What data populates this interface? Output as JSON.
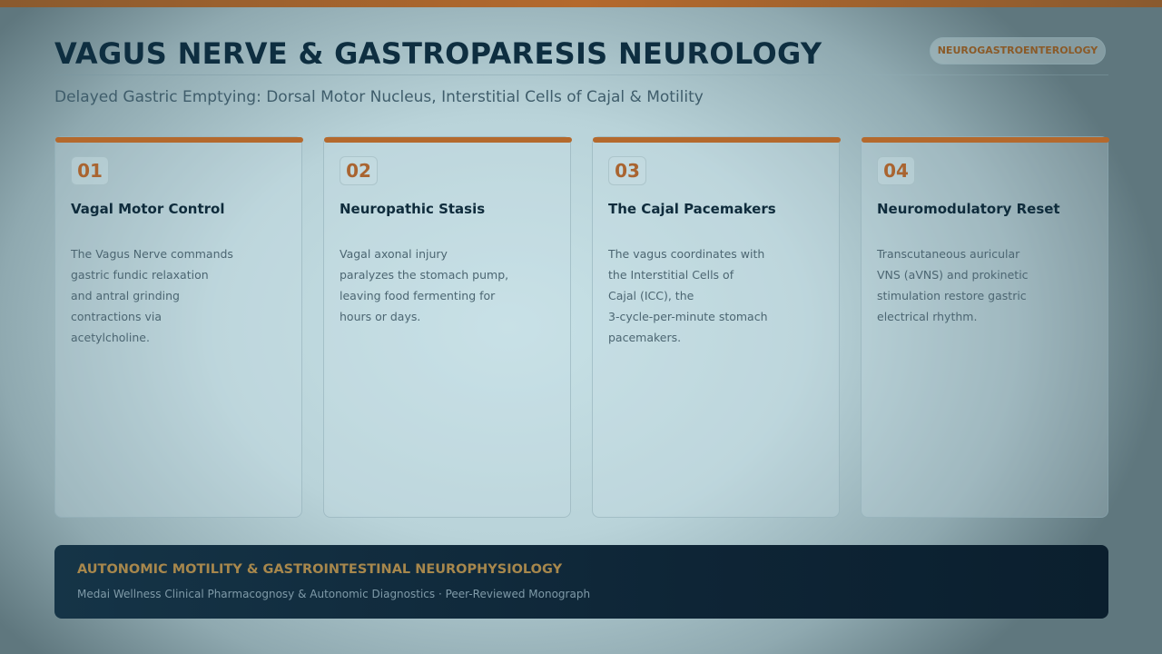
{
  "header": {
    "title": "VAGUS NERVE & GASTROPARESIS NEUROLOGY",
    "subtitle": "Delayed Gastric Emptying: Dorsal Motor Nucleus, Interstitial Cells of Cajal & Motility",
    "tag": "NEUROGASTROENTEROLOGY"
  },
  "cards": [
    {
      "number": "01",
      "title": "Vagal Motor Control",
      "body_lines": [
        "The Vagus Nerve commands",
        "gastric fundic relaxation",
        "and antral grinding",
        "contractions via",
        "acetylcholine."
      ]
    },
    {
      "number": "02",
      "title": "Neuropathic Stasis",
      "body_lines": [
        "Vagal axonal injury",
        "paralyzes the stomach pump,",
        "leaving food fermenting for",
        "hours or days."
      ]
    },
    {
      "number": "03",
      "title": "The Cajal Pacemakers",
      "body_lines": [
        "The vagus coordinates with",
        "the Interstitial Cells of",
        "Cajal (ICC), the",
        "3-cycle-per-minute stomach",
        "pacemakers."
      ]
    },
    {
      "number": "04",
      "title": "Neuromodulatory Reset",
      "body_lines": [
        "Transcutaneous auricular",
        "VNS (aVNS) and prokinetic",
        "stimulation restore gastric",
        "electrical rhythm."
      ]
    }
  ],
  "footer": {
    "title": "AUTONOMIC MOTILITY & GASTROINTESTINAL NEUROPHYSIOLOGY",
    "subtitle": "Medai Wellness Clinical Pharmacognosy & Autonomic Diagnostics · Peer-Reviewed Monograph"
  },
  "colors": {
    "accent": "#b4692d",
    "title": "#0e2e40",
    "footer_bg": "#0e2536",
    "footer_title": "#a7874c"
  }
}
